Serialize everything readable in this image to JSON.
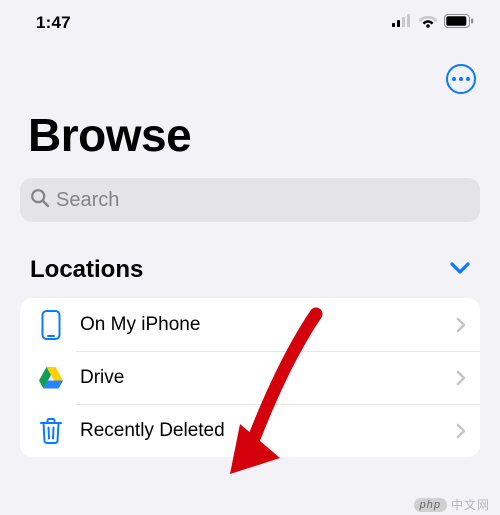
{
  "status": {
    "time": "1:47"
  },
  "header": {
    "title": "Browse",
    "search_placeholder": "Search"
  },
  "sections": {
    "locations": {
      "title": "Locations",
      "items": [
        {
          "label": "On My iPhone",
          "icon": "iphone-icon"
        },
        {
          "label": "Drive",
          "icon": "drive-icon"
        },
        {
          "label": "Recently Deleted",
          "icon": "trash-icon"
        }
      ]
    }
  },
  "colors": {
    "accent": "#0a7aff"
  },
  "watermark": {
    "logo": "php",
    "text": "中文网"
  }
}
